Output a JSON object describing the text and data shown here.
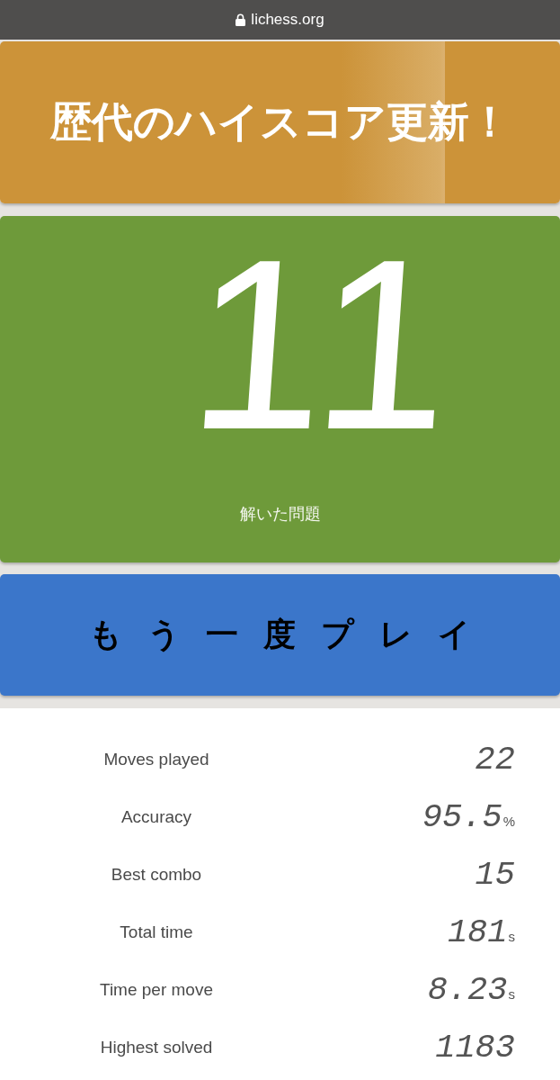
{
  "browser_bar": {
    "url": "lichess.org"
  },
  "banner": {
    "title": "歴代のハイスコア更新！"
  },
  "score": {
    "value": "11",
    "label": "解いた問題"
  },
  "play_again_button": {
    "label": "もう一度プレイ"
  },
  "stats": [
    {
      "label": "Moves played",
      "value": "22"
    },
    {
      "label": "Accuracy",
      "value": "95.5",
      "unit": "%"
    },
    {
      "label": "Best combo",
      "value": "15"
    },
    {
      "label": "Total time",
      "value": "181",
      "unit": "s"
    },
    {
      "label": "Time per move",
      "value": "8.23",
      "unit": "s"
    },
    {
      "label": "Highest solved",
      "value": "1183"
    }
  ]
}
